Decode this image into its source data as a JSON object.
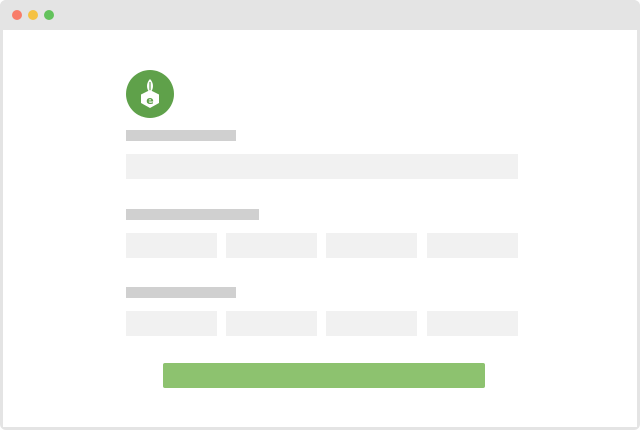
{
  "window": {
    "controls": {
      "close_color": "#f87c69",
      "minimize_color": "#f5c242",
      "maximize_color": "#62c25b"
    }
  },
  "logo": {
    "icon": "leaf-e-badge-icon",
    "glyph": "e",
    "background_color": "#5fa14a"
  },
  "form": {
    "placeholder_label_color": "#d0d0d0",
    "placeholder_input_color": "#f1f1f1",
    "rows": [
      {
        "type": "single-input"
      },
      {
        "type": "four-inputs"
      },
      {
        "type": "four-inputs"
      }
    ],
    "submit": {
      "label": "",
      "color": "#8dc26f"
    }
  }
}
